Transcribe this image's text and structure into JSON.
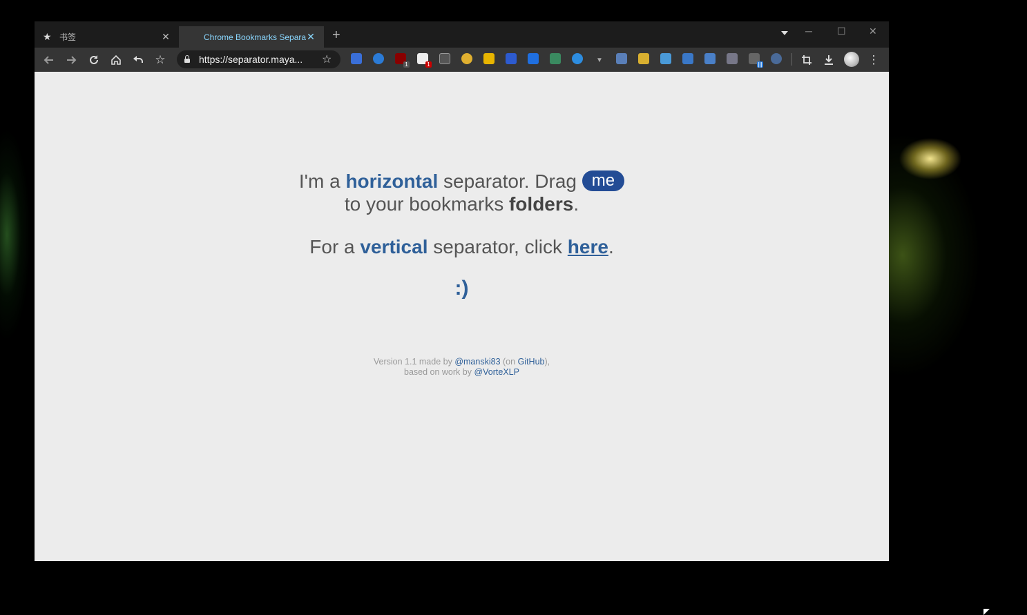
{
  "browser": {
    "tabs": [
      {
        "title": "书签",
        "active": false
      },
      {
        "title": "Chrome Bookmarks Separator",
        "active": true
      }
    ],
    "url": "https://separator.maya..."
  },
  "page": {
    "line1": {
      "prefix": "I'm a",
      "keyword": "horizontal",
      "middle": "separator. Drag",
      "pill": "me"
    },
    "line2": {
      "prefix": "to your bookmarks",
      "keyword": "folders",
      "suffix": "."
    },
    "line3": {
      "prefix": "For a",
      "keyword": "vertical",
      "middle": "separator, click",
      "link": "here",
      "suffix": "."
    },
    "smiley": ":)",
    "footer": {
      "version_text": "Version 1.1 made by",
      "author": "@manski83",
      "on_open": "(on",
      "github": "GitHub",
      "on_close": "),",
      "based_text": "based on work by",
      "credit": "@VorteXLP"
    }
  },
  "colors": {
    "accent": "#2f6099",
    "pill": "#234c95",
    "page_bg": "#ececec",
    "tab_active_text": "#8ad7ff"
  },
  "icons": [
    "star-icon",
    "close-icon",
    "plus-icon",
    "back-arrow-icon",
    "forward-arrow-icon",
    "reload-icon",
    "home-icon",
    "undo-icon",
    "bookmark-star-icon",
    "lock-icon",
    "crop-icon",
    "download-icon",
    "menu-dots-icon"
  ]
}
